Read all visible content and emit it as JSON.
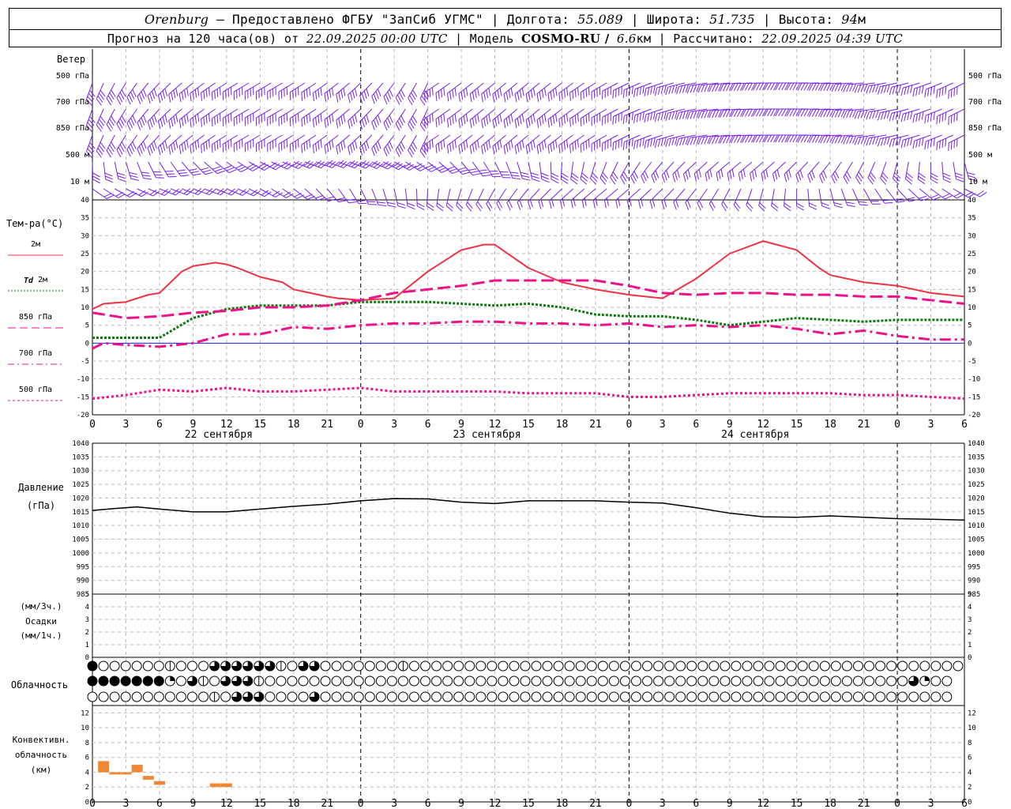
{
  "header": {
    "city": "Orenburg",
    "provider": "— Предоставлено ФГБУ \"ЗапСиб УГМС\"",
    "lon_label": "| Долгота:",
    "lon": "55.089",
    "lat_label": "| Широта:",
    "lat": "51.735",
    "alt_label": "| Высота:",
    "alt": "94",
    "alt_unit": "м",
    "forecast_label": "Прогноз на 120 часа(ов) от",
    "forecast_start": "22.09.2025 00:00 UTC",
    "model_label": "| Модель",
    "model": "COSMO-RU /",
    "res": "6.6",
    "res_unit": "км",
    "calc_label": "| Рассчитано:",
    "calc_time": "22.09.2025 04:39 UTC"
  },
  "labels": {
    "wind": "Ветер",
    "wind_levels": [
      "500 гПа",
      "700 гПа",
      "850 гПа",
      "500 м",
      "10 м"
    ],
    "temp_title": "Тем-ра(°C)",
    "temp_2m": "2м",
    "td": "Td",
    "td_2m": "2м",
    "t850": "850 гПа",
    "t700": "700 гПа",
    "t500": "500 гПа",
    "pressure_1": "Давление",
    "pressure_2": "(гПа)",
    "precip_1": "(мм/3ч.)",
    "precip_2": "Осадки",
    "precip_3": "(мм/1ч.)",
    "cloud": "Облачность",
    "conv_1": "Конвективн.",
    "conv_2": "облачность",
    "conv_3": "(км)",
    "days": [
      "22 сентября",
      "23 сентября",
      "24 сентября"
    ],
    "hour_ticks": [
      "0",
      "3",
      "6",
      "9",
      "12",
      "15",
      "18",
      "21",
      "0",
      "3",
      "6",
      "9",
      "12",
      "15",
      "18",
      "21",
      "0",
      "3",
      "6",
      "9",
      "12",
      "15",
      "18",
      "21",
      "0",
      "3",
      "6"
    ]
  },
  "colors": {
    "t2m": "#ee3344",
    "td": "#117711",
    "upper": "#ee1188",
    "wind": "#7722ee",
    "conv": "#ee8833",
    "zero": "#2222ee"
  },
  "chart_data": [
    {
      "type": "line",
      "name": "temperature",
      "x_unit": "hours since 22.09.2025 00:00 UTC",
      "ylim": [
        -20,
        40
      ],
      "yticks": [
        40,
        35,
        30,
        25,
        20,
        15,
        10,
        5,
        0,
        -5,
        -10,
        -15,
        -20
      ],
      "series": [
        {
          "name": "2м",
          "x": [
            0,
            1,
            3,
            5,
            6,
            8,
            9,
            11,
            12,
            13,
            15,
            17,
            18,
            21,
            22,
            24,
            27,
            30,
            33,
            35,
            36,
            39,
            42,
            45,
            46,
            48,
            51,
            54,
            57,
            60,
            63,
            65,
            66,
            69,
            72,
            75,
            78
          ],
          "values": [
            9.5,
            11,
            11.5,
            13.5,
            14,
            20,
            21.5,
            22.5,
            22,
            21,
            18.5,
            17,
            15,
            13,
            12.5,
            12,
            12.5,
            20,
            26,
            27.5,
            27.5,
            21,
            17,
            15,
            14.5,
            13.5,
            12.5,
            18,
            25,
            28.5,
            26,
            21,
            19,
            17,
            16,
            14,
            13
          ]
        },
        {
          "name": "Td 2м",
          "x": [
            0,
            3,
            6,
            9,
            12,
            15,
            18,
            21,
            24,
            27,
            30,
            33,
            36,
            39,
            42,
            45,
            48,
            51,
            54,
            57,
            60,
            63,
            66,
            69,
            72,
            75,
            78
          ],
          "values": [
            1.5,
            1.5,
            1.5,
            7,
            9.5,
            10.5,
            10.5,
            10.5,
            11.5,
            11.5,
            11.5,
            11,
            10.5,
            11,
            10,
            8,
            7.5,
            7.5,
            6.5,
            5,
            6,
            7,
            6.5,
            6,
            6.5,
            6.5,
            6.5
          ]
        },
        {
          "name": "850 гПа",
          "x": [
            0,
            3,
            6,
            9,
            12,
            15,
            18,
            21,
            24,
            27,
            30,
            33,
            36,
            39,
            42,
            45,
            48,
            51,
            54,
            57,
            60,
            63,
            66,
            69,
            72,
            75,
            78
          ],
          "values": [
            8.5,
            7,
            7.5,
            8.5,
            9,
            10,
            10,
            10.5,
            12,
            14,
            15,
            16,
            17.5,
            17.5,
            17.5,
            17.5,
            16,
            14,
            13.5,
            14,
            14,
            13.5,
            13.5,
            13,
            13,
            12,
            11
          ]
        },
        {
          "name": "700 гПа",
          "x": [
            0,
            1,
            3,
            6,
            9,
            12,
            15,
            18,
            21,
            24,
            27,
            30,
            33,
            36,
            39,
            42,
            45,
            48,
            51,
            54,
            57,
            60,
            63,
            66,
            69,
            72,
            75,
            78
          ],
          "values": [
            -1.5,
            0,
            -0.5,
            -1,
            0,
            2.5,
            2.5,
            4.5,
            4,
            5,
            5.5,
            5.5,
            6,
            6,
            5.5,
            5.5,
            5,
            5.5,
            4.5,
            5,
            4.5,
            5,
            4,
            2.5,
            3.5,
            2,
            1,
            1
          ]
        },
        {
          "name": "500 гПа",
          "x": [
            0,
            3,
            6,
            9,
            12,
            15,
            18,
            21,
            24,
            27,
            30,
            33,
            36,
            39,
            42,
            45,
            48,
            51,
            54,
            57,
            60,
            63,
            66,
            69,
            72,
            75,
            78
          ],
          "values": [
            -15.5,
            -14.5,
            -13,
            -13.5,
            -12.5,
            -13.5,
            -13.5,
            -13,
            -12.5,
            -13.5,
            -13.5,
            -13.5,
            -13.5,
            -14,
            -14,
            -14,
            -15,
            -15,
            -14.5,
            -14,
            -14,
            -14,
            -14,
            -14.5,
            -14.5,
            -15,
            -15.5
          ]
        }
      ]
    },
    {
      "type": "line",
      "name": "pressure",
      "ylim": [
        985,
        1040
      ],
      "yticks": [
        1040,
        1035,
        1030,
        1025,
        1020,
        1015,
        1010,
        1005,
        1000,
        995,
        990,
        985
      ],
      "x": [
        0,
        2,
        4,
        6,
        9,
        12,
        15,
        18,
        21,
        24,
        27,
        30,
        33,
        36,
        39,
        42,
        45,
        48,
        51,
        54,
        57,
        60,
        63,
        66,
        69,
        72,
        75,
        78
      ],
      "values": [
        1015.5,
        1016.2,
        1016.8,
        1016,
        1015,
        1015,
        1016,
        1017,
        1017.8,
        1019,
        1019.8,
        1019.7,
        1018.5,
        1018,
        1019,
        1019,
        1019,
        1018.5,
        1018.2,
        1016.5,
        1014.5,
        1013.2,
        1013,
        1013.5,
        1013,
        1012.5,
        1012.3,
        1012
      ]
    },
    {
      "type": "bar",
      "name": "precipitation",
      "ylim": [
        0,
        5
      ],
      "yticks": [
        5,
        4,
        3,
        2,
        1,
        0
      ],
      "values": []
    },
    {
      "type": "table",
      "name": "cloudiness",
      "rows": [
        "4000000h000tttttth0tt0000000h000000000000000000000000000000000000000000000000000",
        "4444444q0th0ttth0000000000000000000000000000000000000000000000000000000000tq00",
        "00000000000h0ttt0000t000000000000000000000000000000000000000000000000000000000"
      ]
    },
    {
      "type": "bar",
      "name": "convective clouds",
      "ylim": [
        0,
        13
      ],
      "yticks": [
        12,
        10,
        8,
        6,
        4,
        2,
        0
      ],
      "x": [
        1,
        2,
        3,
        4,
        5,
        6,
        11,
        12
      ],
      "top": [
        5.5,
        4,
        4,
        5,
        3.5,
        2.8,
        2.5,
        2.5
      ],
      "base": [
        4,
        3.7,
        3.7,
        4,
        3,
        2.3,
        2,
        2
      ]
    }
  ]
}
